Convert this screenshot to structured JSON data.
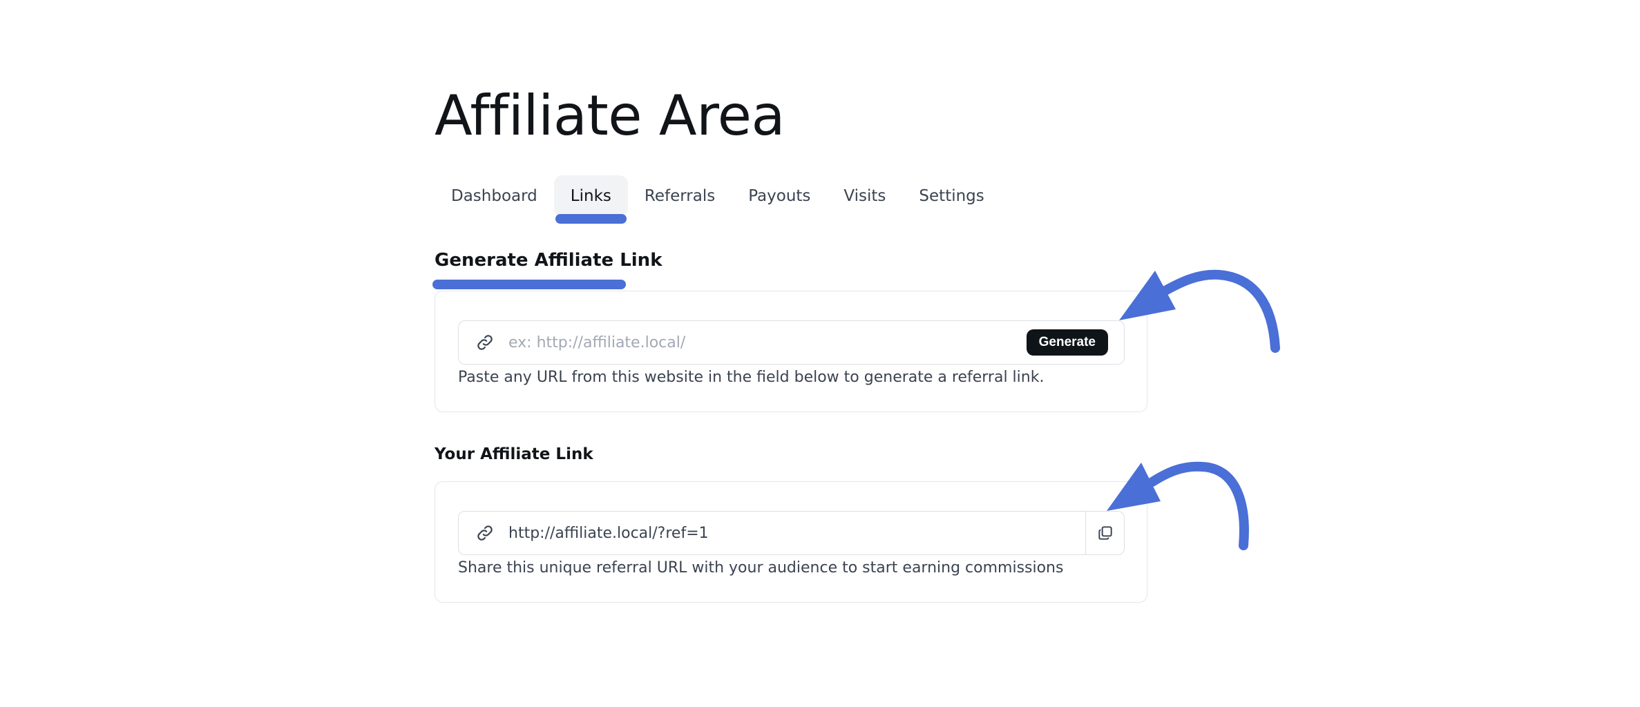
{
  "page": {
    "title": "Affiliate Area"
  },
  "tabs": [
    {
      "label": "Dashboard",
      "active": false
    },
    {
      "label": "Links",
      "active": true
    },
    {
      "label": "Referrals",
      "active": false
    },
    {
      "label": "Payouts",
      "active": false
    },
    {
      "label": "Visits",
      "active": false
    },
    {
      "label": "Settings",
      "active": false
    }
  ],
  "generate_section": {
    "heading": "Generate Affiliate Link",
    "input_value": "",
    "input_placeholder": "ex: http://affiliate.local/",
    "button_label": "Generate",
    "helper_text": "Paste any URL from this website in the field below to generate a referral link."
  },
  "your_link_section": {
    "heading": "Your Affiliate Link",
    "link_value": "http://affiliate.local/?ref=1",
    "helper_text": "Share this unique referral URL with your audience to start earning commissions"
  },
  "icons": {
    "field_icon": "link-icon",
    "copy_icon": "copy-icon",
    "annotation": "curved-arrow-annotation"
  },
  "colors": {
    "accent": "#4a6fd6",
    "button_bg": "#0f1419",
    "text": "#111418",
    "muted_text": "#3b4350",
    "placeholder": "#a3a9b3",
    "border": "#e4e6ea"
  }
}
